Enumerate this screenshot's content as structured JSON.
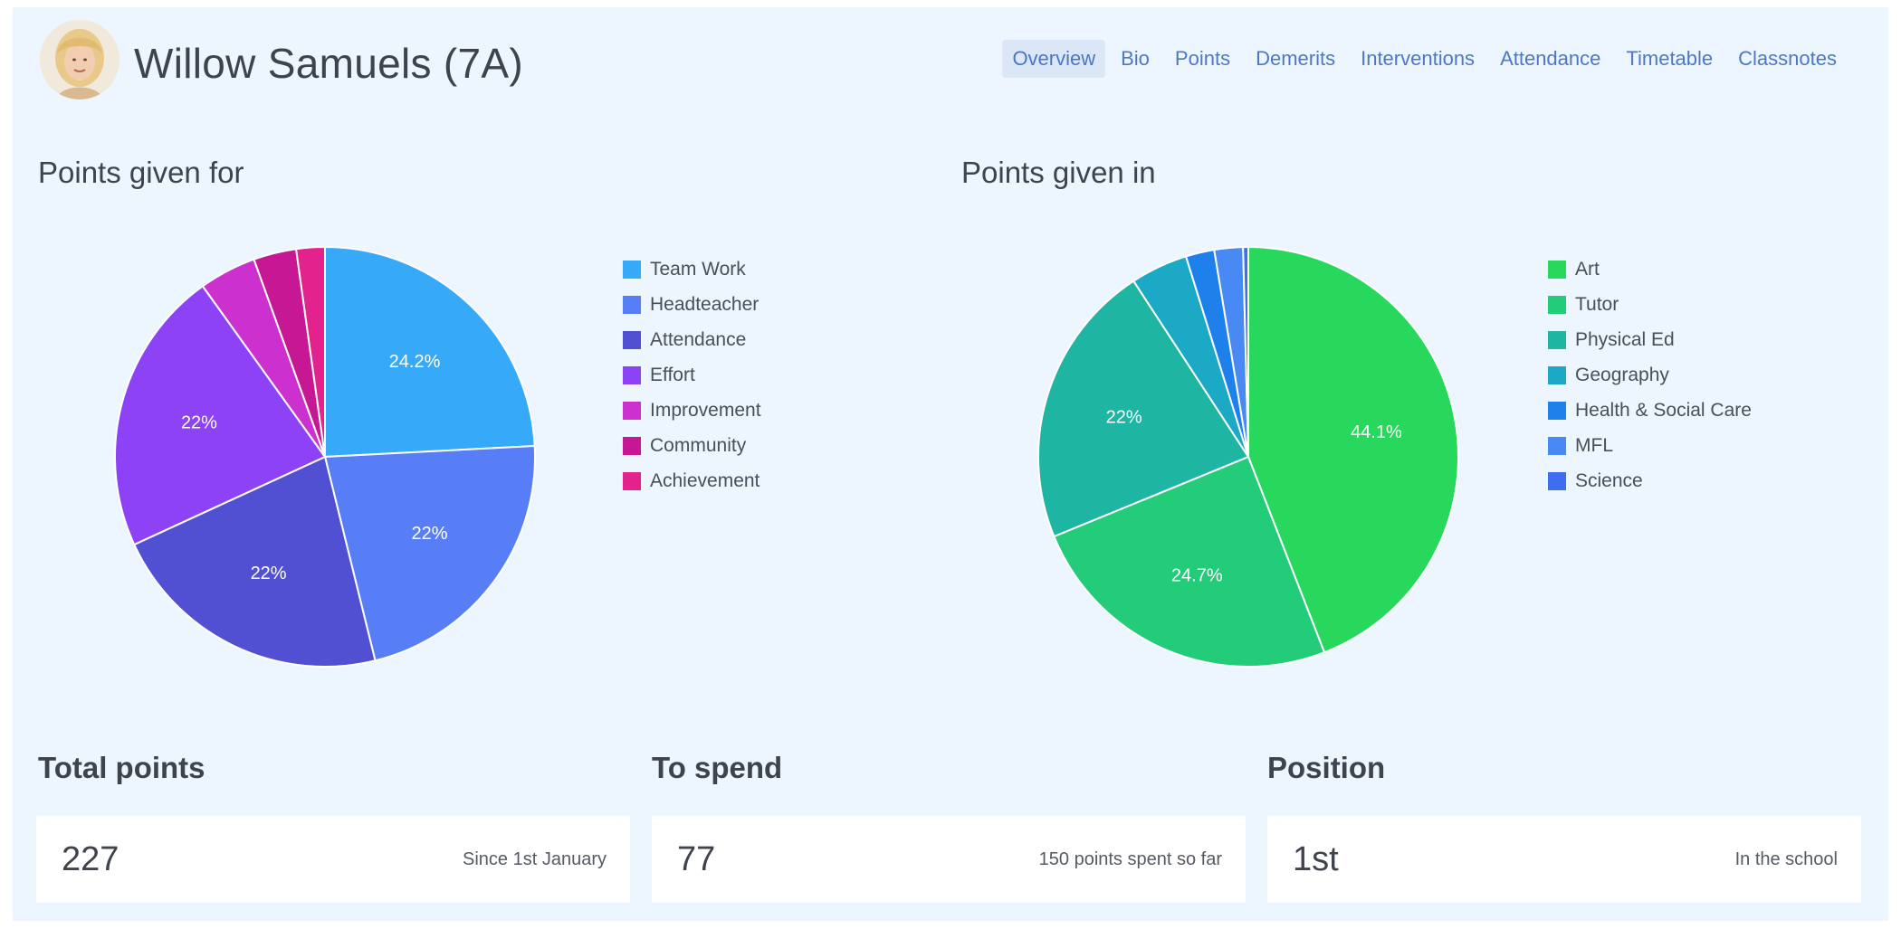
{
  "header": {
    "student_name": "Willow Samuels (7A)",
    "nav_tabs": [
      {
        "label": "Overview",
        "active": true
      },
      {
        "label": "Bio",
        "active": false
      },
      {
        "label": "Points",
        "active": false
      },
      {
        "label": "Demerits",
        "active": false
      },
      {
        "label": "Interventions",
        "active": false
      },
      {
        "label": "Attendance",
        "active": false
      },
      {
        "label": "Timetable",
        "active": false
      },
      {
        "label": "Classnotes",
        "active": false
      }
    ]
  },
  "chart_data": [
    {
      "type": "pie",
      "title": "Points given for",
      "legend_position": "right",
      "categories": [
        "Team Work",
        "Headteacher",
        "Attendance",
        "Effort",
        "Improvement",
        "Community",
        "Achievement"
      ],
      "values": [
        24.2,
        22,
        22,
        22,
        4.4,
        3.3,
        2.2
      ],
      "value_labels": [
        "24.2%",
        "22%",
        "22%",
        "22%",
        "",
        "",
        ""
      ],
      "colors": [
        "#36a9f9",
        "#577ef7",
        "#5150d2",
        "#8d43f5",
        "#cc30cf",
        "#c61895",
        "#e4228d"
      ]
    },
    {
      "type": "pie",
      "title": "Points given in",
      "legend_position": "right",
      "categories": [
        "Art",
        "Tutor",
        "Physical Ed",
        "Geography",
        "Health & Social Care",
        "MFL",
        "Science"
      ],
      "values": [
        44.1,
        24.7,
        22,
        4.4,
        2.2,
        2.2,
        0.4
      ],
      "value_labels": [
        "44.1%",
        "24.7%",
        "22%",
        "",
        "",
        "",
        ""
      ],
      "colors": [
        "#27d85d",
        "#23cc79",
        "#1fb5a3",
        "#1ba9c6",
        "#1e80ea",
        "#4889f3",
        "#3d6ef2"
      ]
    }
  ],
  "stats": [
    {
      "title": "Total points",
      "value": "227",
      "note": "Since 1st January"
    },
    {
      "title": "To spend",
      "value": "77",
      "note": "150 points spent so far"
    },
    {
      "title": "Position",
      "value": "1st",
      "note": "In the school"
    }
  ]
}
